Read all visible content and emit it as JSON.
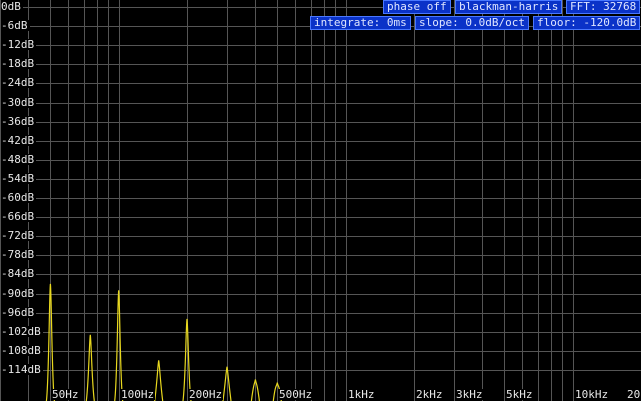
{
  "status_badges_top": [
    {
      "name": "phase-mode-button",
      "label": "phase off"
    },
    {
      "name": "window-function-button",
      "label": "blackman-harris"
    },
    {
      "name": "fft-size-button",
      "label": "FFT: 32768"
    }
  ],
  "status_badges_bottom": [
    {
      "name": "integrate-button",
      "label": "integrate: 0ms"
    },
    {
      "name": "slope-button",
      "label": "slope: 0.0dB/oct"
    },
    {
      "name": "floor-button",
      "label": "floor: -120.0dB"
    }
  ],
  "colors": {
    "background": "#000000",
    "grid": "#555555",
    "grid_minor": "#3a3a3a",
    "label_text": "#e8e8e8",
    "badge_bg": "#0a32c8",
    "badge_border": "#4a78ff",
    "trace": "#e8d81e"
  },
  "chart_data": {
    "type": "line",
    "x_scale": "log",
    "xlim": [
      30,
      20000
    ],
    "ylim": [
      -120,
      0
    ],
    "y_ticks": [
      0,
      -6,
      -12,
      -18,
      -24,
      -30,
      -36,
      -42,
      -48,
      -54,
      -60,
      -66,
      -72,
      -78,
      -84,
      -90,
      -96,
      -102,
      -108,
      -114
    ],
    "y_tick_labels": [
      "0dB",
      "-6dB",
      "-12dB",
      "-18dB",
      "-24dB",
      "-30dB",
      "-36dB",
      "-42dB",
      "-48dB",
      "-54dB",
      "-60dB",
      "-66dB",
      "-72dB",
      "-78dB",
      "-84dB",
      "-90dB",
      "-96dB",
      "-102dB",
      "-108dB",
      "-114dB"
    ],
    "x_ticks": [
      50,
      100,
      200,
      500,
      1000,
      2000,
      3000,
      5000,
      10000,
      20000
    ],
    "x_tick_labels": [
      "50Hz",
      "100Hz",
      "200Hz",
      "500Hz",
      "1kHz",
      "2kHz",
      "3kHz",
      "5kHz",
      "10kHz",
      "20"
    ],
    "grid": true,
    "series": [
      {
        "peaks": [
          {
            "x": 50,
            "y": -87
          },
          {
            "x": 75,
            "y": -103
          },
          {
            "x": 100,
            "y": -89
          },
          {
            "x": 150,
            "y": -111
          },
          {
            "x": 200,
            "y": -98
          },
          {
            "x": 300,
            "y": -113
          },
          {
            "x": 400,
            "y": -117
          },
          {
            "x": 500,
            "y": -118
          }
        ]
      }
    ]
  }
}
